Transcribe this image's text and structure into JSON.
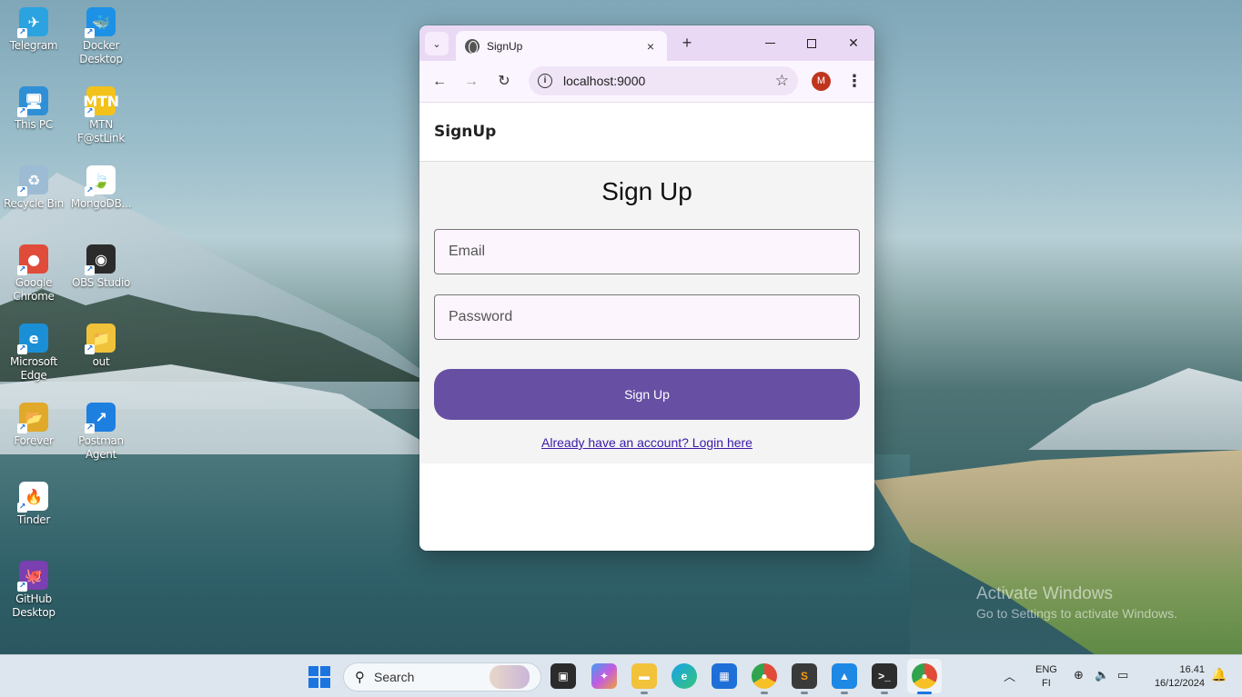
{
  "desktop": {
    "icons": [
      {
        "label": "Telegram",
        "color": "#2aa3e0",
        "glyph": "✈"
      },
      {
        "label": "Docker Desktop",
        "color": "#1d91e6",
        "glyph": "🐳"
      },
      {
        "label": "This PC",
        "color": "#2f8fd6",
        "glyph": "🖥"
      },
      {
        "label": "MTN F@stLink",
        "color": "#f2c21b",
        "glyph": "MTN"
      },
      {
        "label": "Recycle Bin",
        "color": "#9dbcd4",
        "glyph": "♻"
      },
      {
        "label": "MongoDB...",
        "color": "#ffffff",
        "glyph": "🍃"
      },
      {
        "label": "Google Chrome",
        "color": "#e04b3a",
        "glyph": "●"
      },
      {
        "label": "OBS Studio",
        "color": "#2b2b2b",
        "glyph": "◉"
      },
      {
        "label": "Microsoft Edge",
        "color": "#1a8fd6",
        "glyph": "e"
      },
      {
        "label": "out",
        "color": "#f0c23a",
        "glyph": "📁"
      },
      {
        "label": "Forever",
        "color": "#e0a92a",
        "glyph": "📂"
      },
      {
        "label": "Postman Agent",
        "color": "#1d7fe0",
        "glyph": "↗"
      },
      {
        "label": "Tinder",
        "color": "#ffffff",
        "glyph": "🔥"
      },
      {
        "label": "GitHub Desktop",
        "color": "#7a3fb0",
        "glyph": "🐙"
      }
    ]
  },
  "browser": {
    "tab_title": "SignUp",
    "url": "localhost:9000",
    "profile_initial": "M",
    "new_tab": "+",
    "close_tab": "×"
  },
  "page": {
    "brand": "SignUp",
    "title": "Sign Up",
    "email_placeholder": "Email",
    "password_placeholder": "Password",
    "submit_label": "Sign Up",
    "login_link": "Already have an account? Login here",
    "accent_color": "#6750a4"
  },
  "watermark": {
    "line1": "Activate Windows",
    "line2": "Go to Settings to activate Windows."
  },
  "taskbar": {
    "search_label": "Search",
    "lang_line1": "ENG",
    "lang_line2": "FI",
    "time": "16.41",
    "date": "16/12/2024"
  }
}
